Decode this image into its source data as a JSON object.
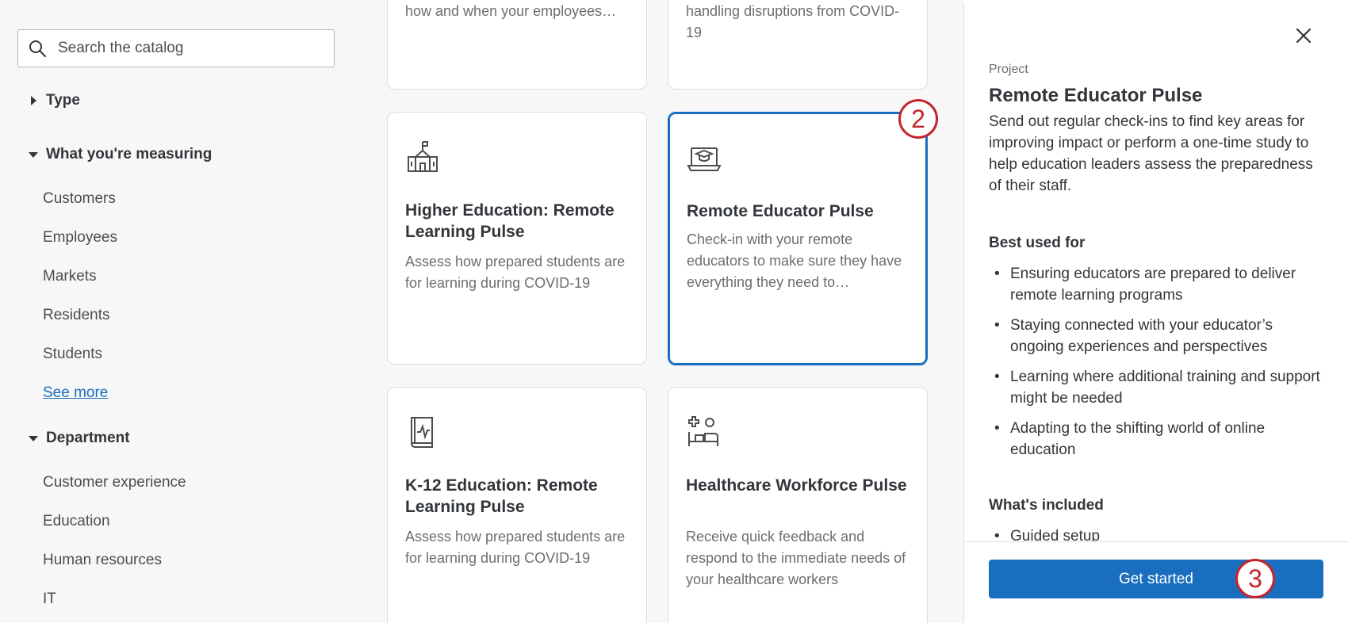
{
  "search": {
    "placeholder": "Search the catalog"
  },
  "filters": {
    "type": {
      "label": "Type"
    },
    "measuring": {
      "label": "What you're measuring",
      "items": [
        "Customers",
        "Employees",
        "Markets",
        "Residents",
        "Students"
      ],
      "see_more": "See more"
    },
    "department": {
      "label": "Department",
      "items": [
        "Customer experience",
        "Education",
        "Human resources",
        "IT"
      ]
    }
  },
  "cards": {
    "top_left_snippet": "how and when your employees…",
    "top_right_snippet_1": "handling disruptions from COVID-",
    "top_right_snippet_2": "19",
    "higher_ed": {
      "title": "Higher Education: Remote Learning Pulse",
      "desc": "Assess how prepared students are for learning during COVID-19",
      "icon": "school-building-icon"
    },
    "remote_educator": {
      "title": "Remote Educator Pulse",
      "desc": "Check-in with your remote educators to make sure they have everything they need to…",
      "icon": "laptop-graduation-cap-icon"
    },
    "k12": {
      "title": "K-12 Education: Remote Learning Pulse",
      "desc": "Assess how prepared students are for learning during COVID-19",
      "icon": "book-heartbeat-icon"
    },
    "healthcare": {
      "title": "Healthcare Workforce Pulse",
      "desc": "Receive quick feedback and respond to the immediate needs of your healthcare workers",
      "icon": "hospital-bed-icon"
    }
  },
  "badges": {
    "step2": "2",
    "step3": "3",
    "color": "#c4242b"
  },
  "detail": {
    "kind": "Project",
    "title": "Remote Educator Pulse",
    "description": "Send out regular check-ins to find key areas for improving impact or perform a one-time study to help education leaders assess the preparedness of their staff.",
    "best_used_for_label": "Best used for",
    "best_used_for": [
      "Ensuring educators are prepared to deliver remote learning programs",
      "Staying connected with your educator’s ongoing experiences and perspectives",
      "Learning where additional training and support might be needed",
      "Adapting to the shifting world of online education"
    ],
    "included_label": "What's included",
    "included": [
      "Guided setup"
    ],
    "cta": "Get started"
  },
  "colors": {
    "accent": "#1a6ec0",
    "sidebar_bg": "#f7f7f7"
  }
}
